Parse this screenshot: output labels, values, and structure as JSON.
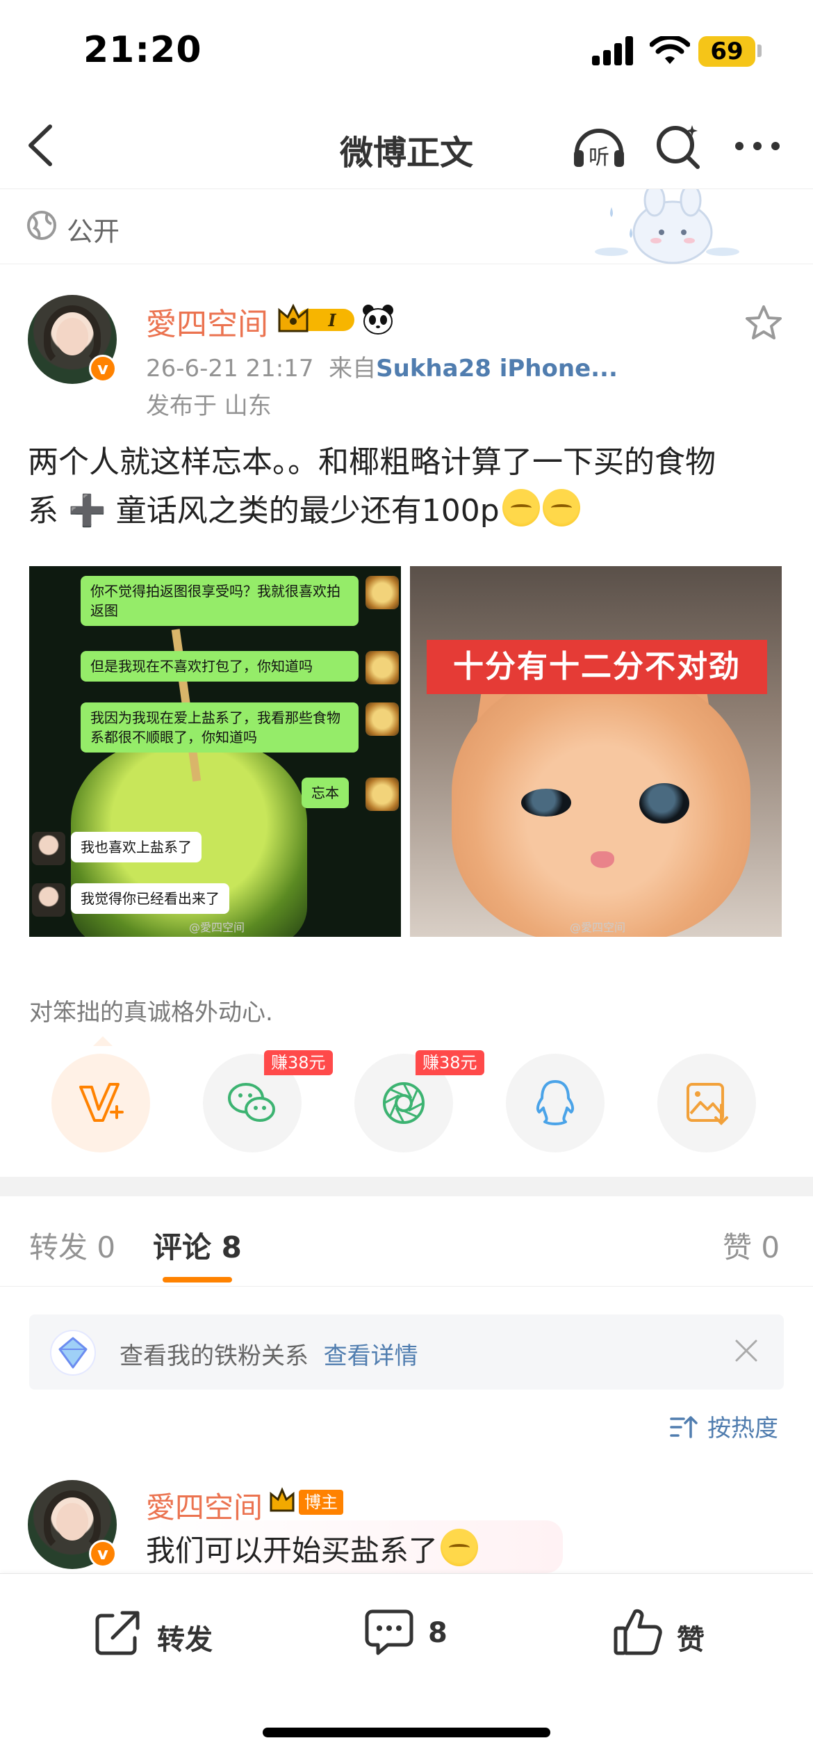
{
  "status_bar": {
    "time": "21:20",
    "battery": "69"
  },
  "nav": {
    "title": "微博正文"
  },
  "visibility": {
    "label": "公开"
  },
  "post": {
    "author": "愛四空间",
    "badge_level": "I",
    "timestamp": "26-6-21 21:17",
    "source_prefix": "来自",
    "source": "Sukha28 iPhone...",
    "location": "发布于 山东",
    "text_line1": "两个人就这样忘本。。和椰粗略计算了一下买的食物",
    "text_line2": "系 ➕ 童话风之类的最少还有100p",
    "caption": "对笨拙的真诚格外动心."
  },
  "image1": {
    "chat": [
      "你不觉得拍返图很享受吗？我就很喜欢拍返图",
      "但是我现在不喜欢打包了，你知道吗",
      "我因为我现在爱上盐系了，我看那些食物系都很不顺眼了，你知道吗",
      "忘本",
      "我也喜欢上盐系了",
      "我觉得你已经看出来了"
    ],
    "watermark": "@愛四空间"
  },
  "image2": {
    "banner": "十分有十二分不对劲",
    "watermark": "@愛四空间"
  },
  "share": {
    "earn_wechat": "赚38元",
    "earn_moments": "赚38元",
    "icons": [
      "weibo-v-plus-icon",
      "wechat-icon",
      "moments-icon",
      "qq-icon",
      "save-image-icon"
    ]
  },
  "tabs": {
    "repost": "转发 0",
    "comment": "评论 8",
    "like": "赞 0"
  },
  "fan_bar": {
    "text": "查看我的铁粉关系",
    "link": "查看详情"
  },
  "sort": {
    "label": "按热度"
  },
  "comment": {
    "author": "愛四空间",
    "tag": "博主",
    "text": "我们可以开始买盐系了"
  },
  "bottom_bar": {
    "repost": "转发",
    "comment_count": "8",
    "like": "赞"
  },
  "colors": {
    "accent": "#ff8200",
    "name": "#eb7350",
    "link": "#507daf"
  }
}
